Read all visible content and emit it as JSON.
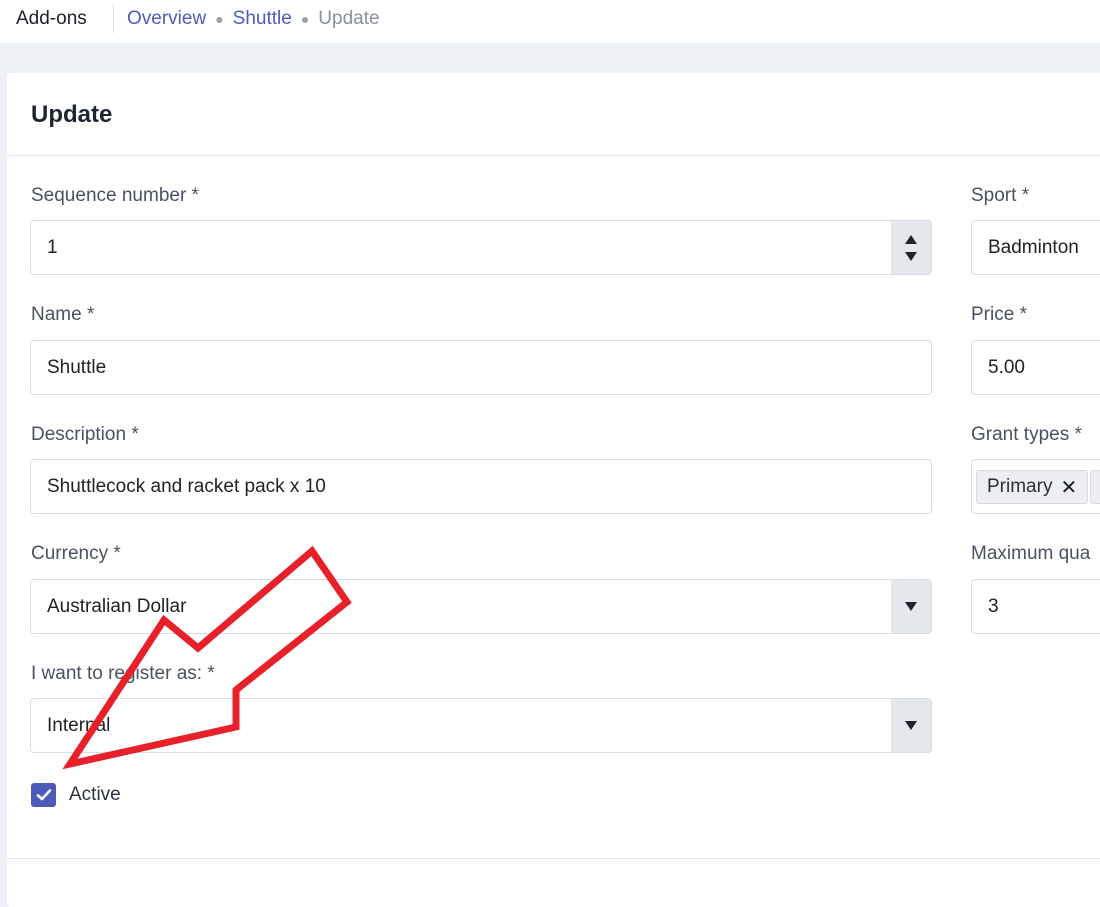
{
  "header": {
    "app_title": "Add-ons",
    "breadcrumb": {
      "overview": "Overview",
      "item": "Shuttle",
      "current": "Update"
    }
  },
  "card": {
    "title": "Update"
  },
  "form": {
    "sequence": {
      "label": "Sequence number *",
      "value": "1"
    },
    "name": {
      "label": "Name *",
      "value": "Shuttle"
    },
    "description": {
      "label": "Description *",
      "value": "Shuttlecock and racket pack x 10"
    },
    "currency": {
      "label": "Currency *",
      "value": "Australian Dollar"
    },
    "register_as": {
      "label": "I want to register as: *",
      "value": "Internal"
    },
    "active": {
      "label": "Active",
      "checked": true
    },
    "sport": {
      "label": "Sport *",
      "value": "Badminton"
    },
    "price": {
      "label": "Price *",
      "value": "5.00"
    },
    "grant_types": {
      "label": "Grant types *",
      "tags": [
        "Primary"
      ]
    },
    "max_quantity": {
      "label": "Maximum qua",
      "value": "3"
    }
  },
  "icons": {
    "tag_remove": "close-icon",
    "dropdown": "chevron-down-icon",
    "spinner": "spinner-arrows-icon",
    "check": "checkmark-icon"
  },
  "colors": {
    "accent": "#4f5bb8",
    "annotation_arrow": "#e8202a",
    "background": "#edf0f4"
  }
}
